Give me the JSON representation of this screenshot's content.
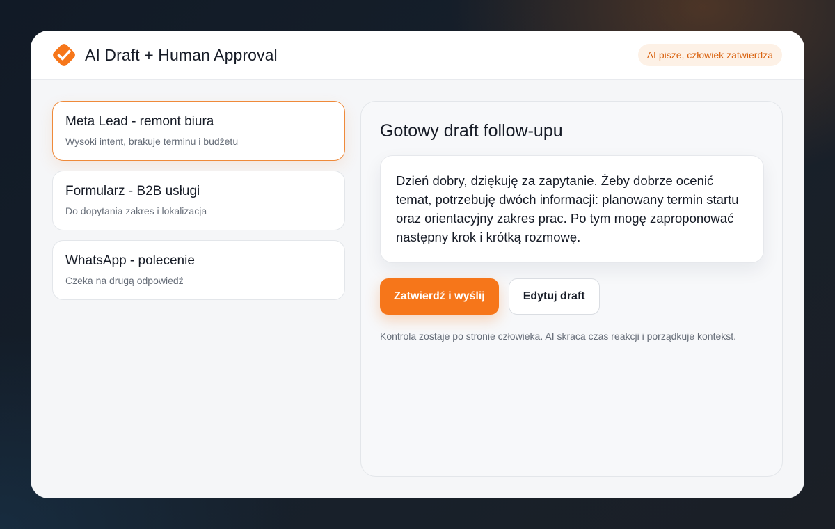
{
  "app": {
    "title": "AI Draft + Human Approval",
    "badge": "AI pisze, człowiek zatwierdza",
    "accent_color": "#f6761a",
    "logo_icon": "checkmark-icon"
  },
  "leads": [
    {
      "title": "Meta Lead - remont biura",
      "subtitle": "Wysoki intent, brakuje terminu i budżetu",
      "active": true
    },
    {
      "title": "Formularz - B2B usługi",
      "subtitle": "Do dopytania zakres i lokalizacja",
      "active": false
    },
    {
      "title": "WhatsApp - polecenie",
      "subtitle": "Czeka na drugą odpowiedź",
      "active": false
    }
  ],
  "draft": {
    "title": "Gotowy draft follow-upu",
    "body": "Dzień dobry, dziękuję za zapytanie. Żeby dobrze ocenić temat, potrzebuję dwóch informacji: planowany termin startu oraz orientacyjny zakres prac. Po tym mogę zaproponować następny krok i krótką rozmowę.",
    "approve_label": "Zatwierdź i wyślij",
    "edit_label": "Edytuj draft",
    "note": "Kontrola zostaje po stronie człowieka. AI skraca czas reakcji i porządkuje kontekst."
  }
}
